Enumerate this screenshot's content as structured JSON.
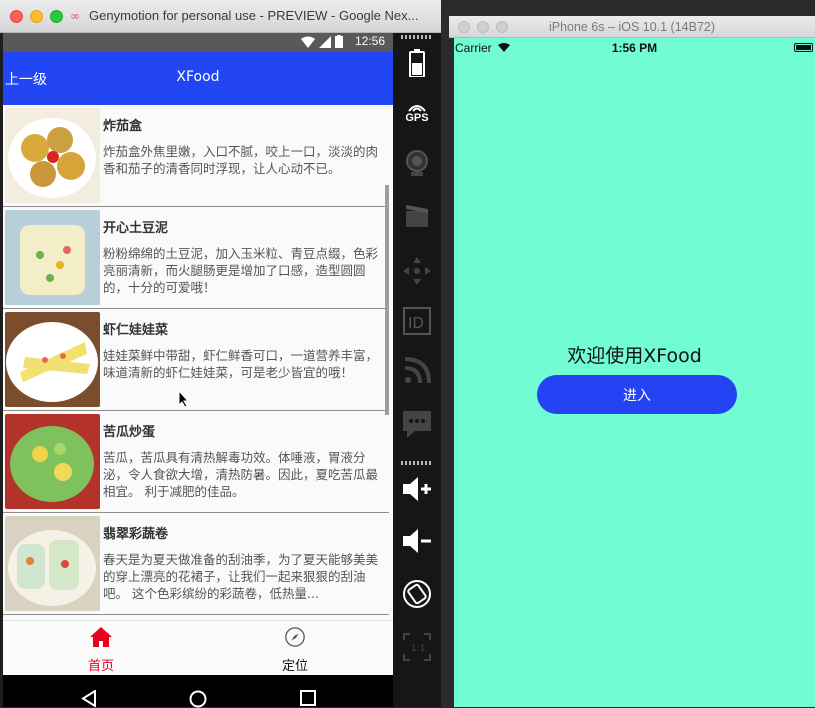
{
  "genymotion": {
    "window_title": "Genymotion for personal use - PREVIEW - Google Nex...",
    "status_bar": {
      "time": "12:56"
    },
    "app_bar": {
      "back_label": "上一级",
      "title": "XFood"
    },
    "recipes": [
      {
        "name": "炸茄盒",
        "desc": "炸茄盒外焦里嫩，入口不腻，咬上一口，淡淡的肉香和茄子的清香同时浮现，让人心动不已。"
      },
      {
        "name": "开心土豆泥",
        "desc": "粉粉绵绵的土豆泥，加入玉米粒、青豆点缀，色彩亮丽清新，而火腿肠更是增加了口感，造型圆圆的，十分的可爱哦！"
      },
      {
        "name": "虾仁娃娃菜",
        "desc": "娃娃菜鲜中带甜，虾仁鲜香可口，一道营养丰富，味道清新的虾仁娃娃菜，可是老少皆宜的哦！"
      },
      {
        "name": "苦瓜炒蛋",
        "desc": "苦瓜，苦瓜具有清热解毒功效。体唾液，胃液分泌，令人食欲大增，清热防暑。因此，夏吃苦瓜最相宜。 利于减肥的佳品。"
      },
      {
        "name": "翡翠彩蔬卷",
        "desc": "春天是为夏天做准备的刮油季，为了夏天能够美美的穿上漂亮的花裙子，让我们一起来狠狠的刮油吧。 这个色彩缤纷的彩蔬卷，低热量..."
      }
    ],
    "tabs": [
      {
        "label": "首页",
        "icon": "home-icon",
        "active": true
      },
      {
        "label": "定位",
        "icon": "compass-icon",
        "active": false
      }
    ],
    "sidebar": {
      "gps_label": "GPS"
    },
    "colors": {
      "app_bar": "#2346f4",
      "active_tab": "#e8001c"
    }
  },
  "simulator": {
    "window_title": "iPhone 6s – iOS 10.1 (14B72)",
    "status": {
      "carrier": "Carrier",
      "time": "1:56 PM"
    },
    "welcome": "欢迎使用XFood",
    "enter_label": "进入",
    "colors": {
      "background": "#72fcd3",
      "button": "#2343f5"
    }
  }
}
